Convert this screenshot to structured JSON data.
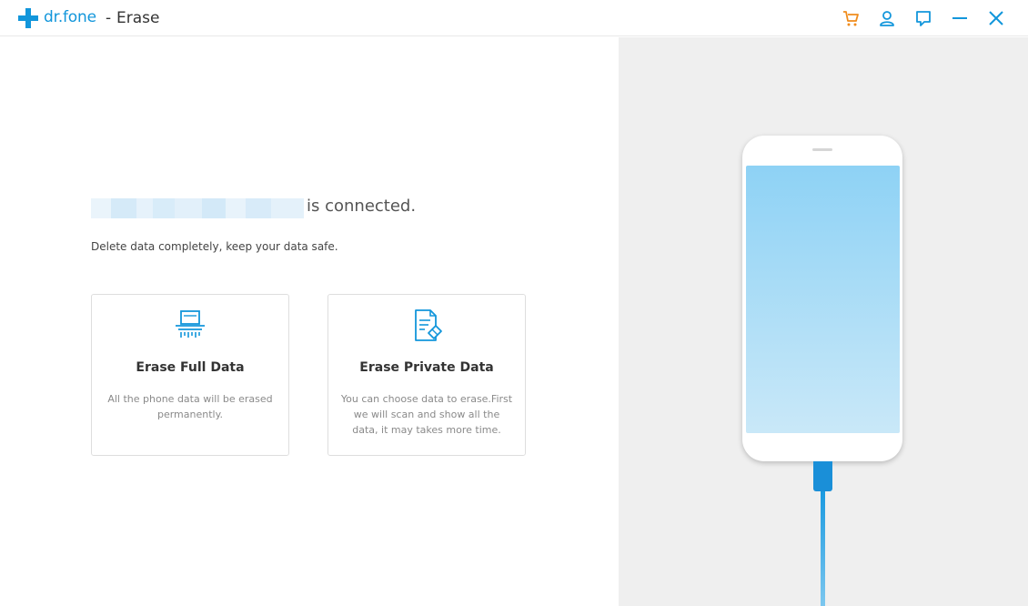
{
  "window": {
    "brand": "dr.fone",
    "separator": "-",
    "title": "Erase"
  },
  "titlebar_icons": {
    "cart": "cart-icon",
    "account": "account-icon",
    "feedback": "feedback-icon",
    "minimize": "minimize-icon",
    "close": "close-icon"
  },
  "device": {
    "status_text": "is connected.",
    "subtitle": "Delete data completely, keep your data safe."
  },
  "options": [
    {
      "title": "Erase Full Data",
      "description": "All the phone data will be erased permanently.",
      "icon": "shredder-icon"
    },
    {
      "title": "Erase Private Data",
      "description": "You can choose data to erase.First we will scan and show all the data, it may takes more time.",
      "icon": "document-eraser-icon"
    }
  ],
  "colors": {
    "accent": "#1296db",
    "cart": "#f08c1c",
    "right_panel": "#efefef",
    "screen_top": "#8ed2f5",
    "screen_bottom": "#c9e8f8"
  }
}
